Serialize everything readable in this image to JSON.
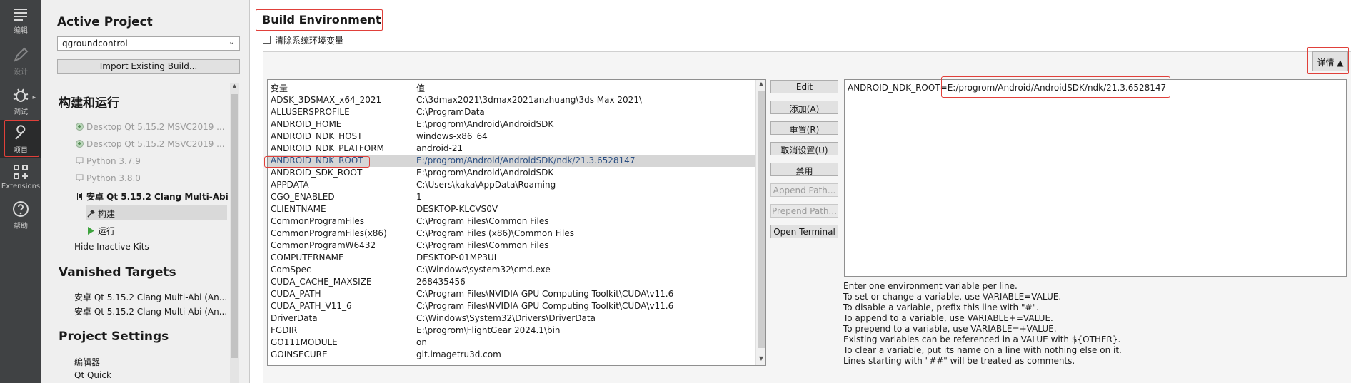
{
  "modes": [
    {
      "label": "编辑",
      "icon": "edit-icon",
      "state": "normal"
    },
    {
      "label": "设计",
      "icon": "design-icon",
      "state": "disabled"
    },
    {
      "label": "调试",
      "icon": "debug-icon",
      "state": "normal"
    },
    {
      "label": "项目",
      "icon": "wrench-icon",
      "state": "active"
    },
    {
      "label": "Extensions",
      "icon": "extensions-icon",
      "state": "normal"
    },
    {
      "label": "帮助",
      "icon": "help-icon",
      "state": "normal"
    }
  ],
  "nav": {
    "active_project_heading": "Active Project",
    "project_combo": "qgroundcontrol",
    "import_button": "Import Existing Build...",
    "build_run_heading": "构建和运行",
    "kits": [
      "Desktop Qt 5.15.2 MSVC2019 ...",
      "Desktop Qt 5.15.2 MSVC2019 ...",
      "Python 3.7.9",
      "Python 3.8.0",
      "安卓 Qt 5.15.2 Clang Multi-Abi"
    ],
    "build_item": "构建",
    "run_item": "运行",
    "hide_inactive": "Hide Inactive Kits",
    "vanished_heading": "Vanished Targets",
    "vanished": [
      "安卓 Qt 5.15.2 Clang Multi-Abi (An...",
      "安卓 Qt 5.15.2 Clang Multi-Abi (An..."
    ],
    "settings_heading": "Project Settings",
    "settings": [
      "编辑器",
      "Qt Quick"
    ]
  },
  "main": {
    "title": "Build Environment",
    "clear_env_label": "清除系统环境变量",
    "details_button": "详情",
    "col_variable": "变量",
    "col_value": "值",
    "rows": [
      {
        "name": "ADSK_3DSMAX_x64_2021",
        "value": "C:\\3dmax2021\\3dmax2021anzhuang\\3ds Max 2021\\"
      },
      {
        "name": "ALLUSERSPROFILE",
        "value": "C:\\ProgramData"
      },
      {
        "name": "ANDROID_HOME",
        "value": "E:\\progrom\\Android\\AndroidSDK"
      },
      {
        "name": "ANDROID_NDK_HOST",
        "value": "windows-x86_64"
      },
      {
        "name": "ANDROID_NDK_PLATFORM",
        "value": "android-21"
      },
      {
        "name": "ANDROID_NDK_ROOT",
        "value": "E:/progrom/Android/AndroidSDK/ndk/21.3.6528147"
      },
      {
        "name": "ANDROID_SDK_ROOT",
        "value": "E:\\progrom\\Android\\AndroidSDK"
      },
      {
        "name": "APPDATA",
        "value": "C:\\Users\\kaka\\AppData\\Roaming"
      },
      {
        "name": "CGO_ENABLED",
        "value": "1"
      },
      {
        "name": "CLIENTNAME",
        "value": "DESKTOP-KLCVS0V"
      },
      {
        "name": "CommonProgramFiles",
        "value": "C:\\Program Files\\Common Files"
      },
      {
        "name": "CommonProgramFiles(x86)",
        "value": "C:\\Program Files (x86)\\Common Files"
      },
      {
        "name": "CommonProgramW6432",
        "value": "C:\\Program Files\\Common Files"
      },
      {
        "name": "COMPUTERNAME",
        "value": "DESKTOP-01MP3UL"
      },
      {
        "name": "ComSpec",
        "value": "C:\\Windows\\system32\\cmd.exe"
      },
      {
        "name": "CUDA_CACHE_MAXSIZE",
        "value": "268435456"
      },
      {
        "name": "CUDA_PATH",
        "value": "C:\\Program Files\\NVIDIA GPU Computing Toolkit\\CUDA\\v11.6"
      },
      {
        "name": "CUDA_PATH_V11_6",
        "value": "C:\\Program Files\\NVIDIA GPU Computing Toolkit\\CUDA\\v11.6"
      },
      {
        "name": "DriverData",
        "value": "C:\\Windows\\System32\\Drivers\\DriverData"
      },
      {
        "name": "FGDIR",
        "value": "E:\\progrom\\FlightGear 2024.1\\bin"
      },
      {
        "name": "GO111MODULE",
        "value": "on"
      },
      {
        "name": "GOINSECURE",
        "value": "git.imagetru3d.com"
      }
    ],
    "buttons": [
      {
        "label": "Edit",
        "enabled": true
      },
      {
        "label": "添加(A)",
        "enabled": true
      },
      {
        "label": "重置(R)",
        "enabled": true
      },
      {
        "label": "取消设置(U)",
        "enabled": true
      },
      {
        "label": "禁用",
        "enabled": true
      },
      {
        "label": "Append Path...",
        "enabled": false
      },
      {
        "label": "Prepend Path...",
        "enabled": false
      },
      {
        "label": "Open Terminal",
        "enabled": true
      }
    ],
    "editor_text": "ANDROID_NDK_ROOT=E:/progrom/Android/AndroidSDK/ndk/21.3.6528147",
    "help_lines": [
      "Enter one environment variable per line.",
      "To set or change a variable, use VARIABLE=VALUE.",
      "To disable a variable, prefix this line with \"#\".",
      "To append to a variable, use VARIABLE+=VALUE.",
      "To prepend to a variable, use VARIABLE=+VALUE.",
      "Existing variables can be referenced in a VALUE with ${OTHER}.",
      "To clear a variable, put its name on a line with nothing else on it.",
      "Lines starting with \"##\" will be treated as comments."
    ]
  }
}
